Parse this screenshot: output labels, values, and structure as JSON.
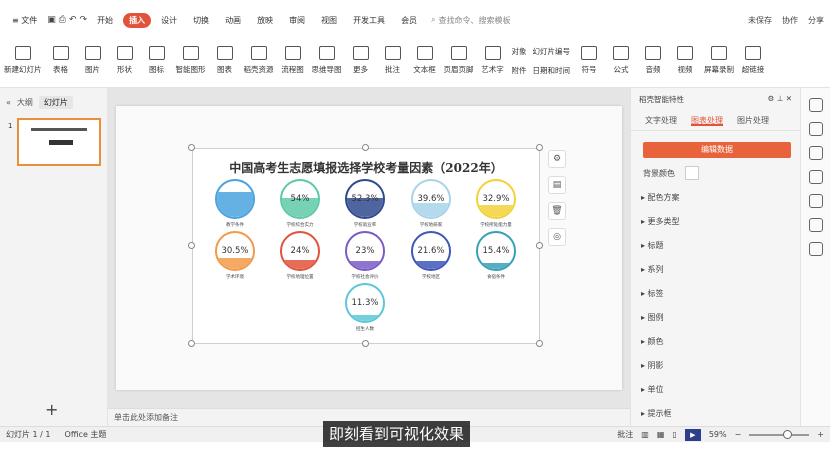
{
  "menubar": {
    "file": "≡ 文件",
    "tabs": [
      "开始",
      "插入",
      "设计",
      "切换",
      "动画",
      "放映",
      "审阅",
      "视图",
      "开发工具",
      "会员"
    ],
    "active_tab": "插入",
    "search": "查找命令、搜索模板",
    "right": [
      "未保存",
      "协作",
      "分享"
    ]
  },
  "ribbon": {
    "items": [
      "新建幻灯片",
      "表格",
      "图片",
      "形状",
      "图标",
      "智能图形",
      "图表",
      "稻壳资源",
      "流程图",
      "思维导图",
      "更多",
      "批注",
      "文本框",
      "页眉页脚",
      "艺术字"
    ],
    "col1": [
      "对象",
      "附件"
    ],
    "col2": [
      "幻灯片编号",
      "日期和时间"
    ],
    "items2": [
      "符号",
      "公式",
      "音频",
      "视频",
      "屏幕录制",
      "超链接"
    ]
  },
  "left_panel": {
    "tab_outline": "大纲",
    "tab_slides": "幻灯片",
    "slide_number": "1"
  },
  "chart_data": {
    "type": "bubble-percent",
    "title": "中国高考生志愿填报选择学校考量因素（2022年）",
    "items": [
      {
        "label": "教学条件",
        "value": "",
        "color": "#4aa3df"
      },
      {
        "label": "学校综合实力",
        "value": "54%",
        "color": "#5ec9a8"
      },
      {
        "label": "学校就业率",
        "value": "52.3%",
        "color": "#2f4a8f"
      },
      {
        "label": "学校地研家",
        "value": "39.6%",
        "color": "#a8d4ea"
      },
      {
        "label": "学校所处能力量",
        "value": "32.9%",
        "color": "#f2d23c"
      },
      {
        "label": "学术环境",
        "value": "30.5%",
        "color": "#f29a4a"
      },
      {
        "label": "学校地理位置",
        "value": "24%",
        "color": "#e1543b"
      },
      {
        "label": "学校社会评价",
        "value": "23%",
        "color": "#7a5bc7"
      },
      {
        "label": "学校地区",
        "value": "21.6%",
        "color": "#3f57b8"
      },
      {
        "label": "食宿条件",
        "value": "15.4%",
        "color": "#3aa0b8"
      },
      {
        "label": "招生人数",
        "value": "11.3%",
        "color": "#5cc7d9"
      }
    ]
  },
  "notes": "单击此处添加备注",
  "right_panel": {
    "title": "稻壳智能特性",
    "tabs": [
      "文字处理",
      "图表处理",
      "图片处理"
    ],
    "active_tab": "图表处理",
    "edit_button": "编辑数据",
    "bg_label": "背景颜色",
    "sections": [
      "配色方案",
      "更多类型",
      "标题",
      "系列",
      "标签",
      "图例",
      "颜色",
      "阴影",
      "单位",
      "提示框"
    ]
  },
  "status": {
    "slide": "幻灯片 1 / 1",
    "theme": "Office 主题",
    "comment": "批注",
    "zoom": "59%"
  },
  "subtitle": "即刻看到可视化效果"
}
